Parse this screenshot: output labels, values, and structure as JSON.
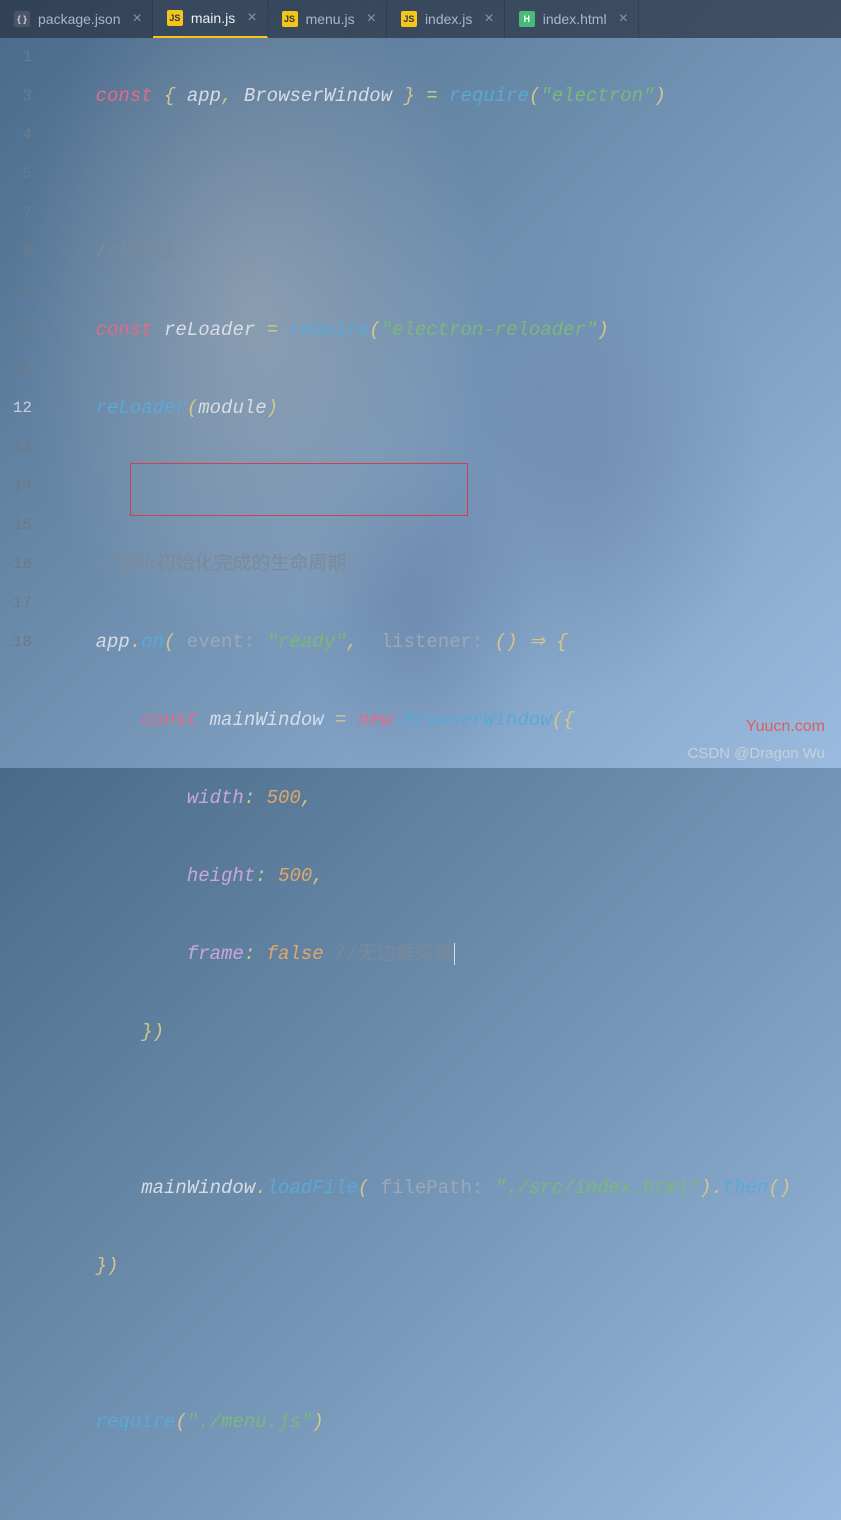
{
  "tabs": [
    {
      "name": "package.json",
      "icon": "json",
      "active": false
    },
    {
      "name": "main.js",
      "icon": "js",
      "active": true
    },
    {
      "name": "menu.js",
      "icon": "js",
      "active": false
    },
    {
      "name": "index.js",
      "icon": "js",
      "active": false
    },
    {
      "name": "index.html",
      "icon": "html",
      "active": false
    }
  ],
  "iconLabels": {
    "json": "{ }",
    "js": "JS",
    "html": "H"
  },
  "gutter": [
    "1",
    "",
    "3",
    "4",
    "5",
    "",
    "7",
    "8",
    "9",
    "10",
    "11",
    "12",
    "13",
    "14",
    "15",
    "16",
    "17",
    "18"
  ],
  "currentLine": 12,
  "code": {
    "l1": {
      "kw": "const",
      "p1": " { ",
      "id1": "app",
      "c1": ", ",
      "id2": "BrowserWindow",
      "p2": " } ",
      "op": "=",
      "sp": " ",
      "fn": "require",
      "po": "(",
      "str": "\"electron\"",
      "pc": ")"
    },
    "l3": {
      "cm": "//热加载"
    },
    "l4": {
      "kw": "const",
      "sp": " ",
      "id": "reLoader",
      "sp2": " ",
      "op": "=",
      "sp3": " ",
      "fn": "require",
      "po": "(",
      "str": "\"electron-reloader\"",
      "pc": ")"
    },
    "l5": {
      "fn": "reLoader",
      "po": "(",
      "id": "module",
      "pc": ")"
    },
    "l7": {
      "cm": "//监听初始化完成的生命周期"
    },
    "l8": {
      "id": "app",
      "dot": ".",
      "fn": "on",
      "po": "(",
      "pl1": " event: ",
      "str": "\"ready\"",
      "c": ",",
      "sp": "  ",
      "pl2": "listener: ",
      "p2": "() ",
      "ar": "⇒",
      "sp2": " ",
      "br": "{"
    },
    "l9": {
      "kw": "const",
      "sp": " ",
      "id": "mainWindow",
      "sp2": " ",
      "op": "=",
      "sp3": " ",
      "kw2": "new",
      "sp4": " ",
      "cls": "BrowserWindow",
      "po": "(",
      "br": "{"
    },
    "l10": {
      "prop": "width",
      "col": ": ",
      "num": "500",
      "c": ","
    },
    "l11": {
      "prop": "height",
      "col": ": ",
      "num": "500",
      "c": ","
    },
    "l12": {
      "prop": "frame",
      "col": ": ",
      "val": "false",
      "sp": " ",
      "cm": "//无边框菜单"
    },
    "l13": {
      "br": "})"
    },
    "l15": {
      "id": "mainWindow",
      "dot": ".",
      "fn": "loadFile",
      "po": "(",
      "pl": " filePath: ",
      "str": "\"./src/index.html\"",
      "pc": ")",
      "dot2": ".",
      "fn2": "then",
      "po2": "(",
      ")": ")"
    },
    "l16": {
      "br": "})"
    },
    "l18": {
      "fn": "require",
      "po": "(",
      "str": "\"./menu.js\"",
      "pc": ")"
    }
  },
  "watermark": "Yuucn.com",
  "credit": "CSDN @Dragon  Wu"
}
